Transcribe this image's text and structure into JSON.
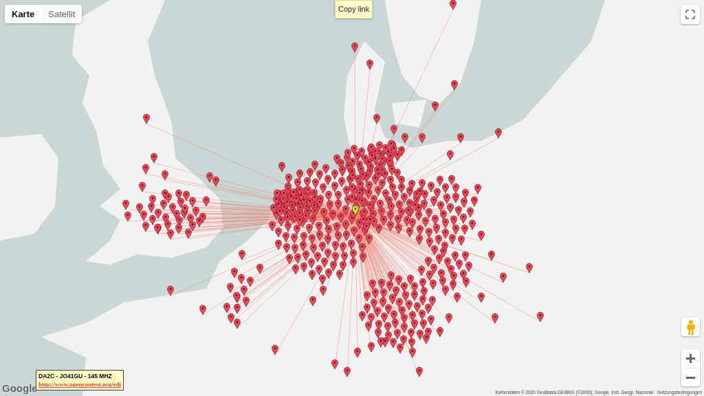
{
  "map_type_tabs": [
    {
      "label": "Karte",
      "selected": true
    },
    {
      "label": "Satellit",
      "selected": false
    }
  ],
  "tooltip": {
    "text": "Copy link"
  },
  "info_box": {
    "title": "DA2C - JO41GU - 145 MHZ",
    "link": "http://www.opencontest.org/edi"
  },
  "logo": "Google",
  "attribution": {
    "text": "Kartendaten © 2020 GeoBasis-DE/BKG (©2009), Google, Inst. Geogr. Nacional",
    "terms_link": "Nutzungsbedingungen"
  }
}
